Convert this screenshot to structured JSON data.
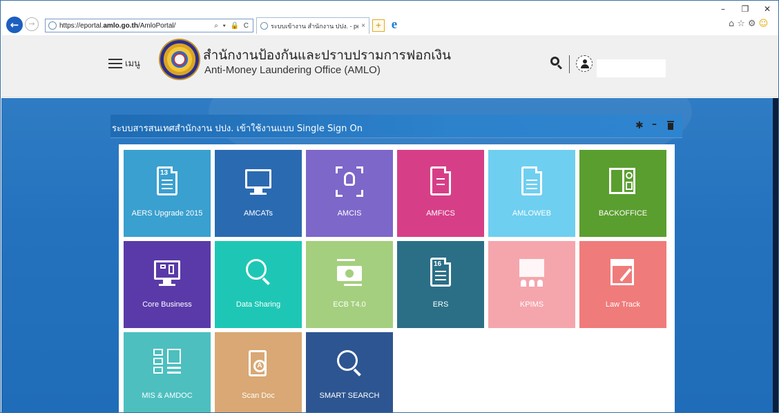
{
  "browser": {
    "url_prefix": "https://eportal.",
    "url_domain": "amlo.go.th",
    "url_path": "/AmloPortal/",
    "address_tools": "⌕ ▾ 🔒 C",
    "tab_title": "ระบบเข้างาน สำนักงาน ปปง. - pe...",
    "tab_close": "×",
    "minimize": "–",
    "maximize": "❐",
    "close": "✕",
    "tools_icons": "⌂☆⚙",
    "smile": "☺"
  },
  "header": {
    "menu_label": "เมนู",
    "org_name_th": "สำนักงานป้องกันและปราบปรามการฟอกเงิน",
    "org_name_en": "Anti-Money Laundering Office (AMLO)"
  },
  "panel": {
    "title": "ระบบสารสนเทศสำนักงาน ปปง. เข้าใช้งานแบบ Single Sign On",
    "gear": "✱",
    "minimize": "–"
  },
  "tiles": [
    {
      "label": "AERS Upgrade 2015",
      "color": "#3aa0cf",
      "icon": "document-13-icon",
      "num": "13"
    },
    {
      "label": "AMCATs",
      "color": "#2a6ab1",
      "icon": "monitor-icon"
    },
    {
      "label": "AMCIS",
      "color": "#7d67c9",
      "icon": "face-scan-icon"
    },
    {
      "label": "AMFICS",
      "color": "#d63f87",
      "icon": "document-exchange-icon"
    },
    {
      "label": "AMLOWEB",
      "color": "#6fcff0",
      "icon": "document-lines-icon"
    },
    {
      "label": "BACKOFFICE",
      "color": "#5a9e2f",
      "icon": "forms-icon"
    },
    {
      "label": "Core Business",
      "color": "#5a3aa8",
      "icon": "hierarchy-monitor-icon"
    },
    {
      "label": "Data Sharing",
      "color": "#1ec7b5",
      "icon": "magnifier-icon"
    },
    {
      "label": "ECB T4.0",
      "color": "#a4cf7e",
      "icon": "money-transfer-icon"
    },
    {
      "label": "ERS",
      "color": "#2b6f86",
      "icon": "document-16-icon",
      "num": "16"
    },
    {
      "label": "KPIMS",
      "color": "#f5a6ad",
      "icon": "presentation-icon"
    },
    {
      "label": "Law Track",
      "color": "#f07b7b",
      "icon": "browser-tools-icon"
    },
    {
      "label": "MIS & AMDOC",
      "color": "#4dbfbf",
      "icon": "checklist-icon"
    },
    {
      "label": "Scan Doc",
      "color": "#d9a874",
      "icon": "clipboard-scan-icon"
    },
    {
      "label": "SMART SEARCH",
      "color": "#2d5591",
      "icon": "magnifier-icon"
    }
  ]
}
